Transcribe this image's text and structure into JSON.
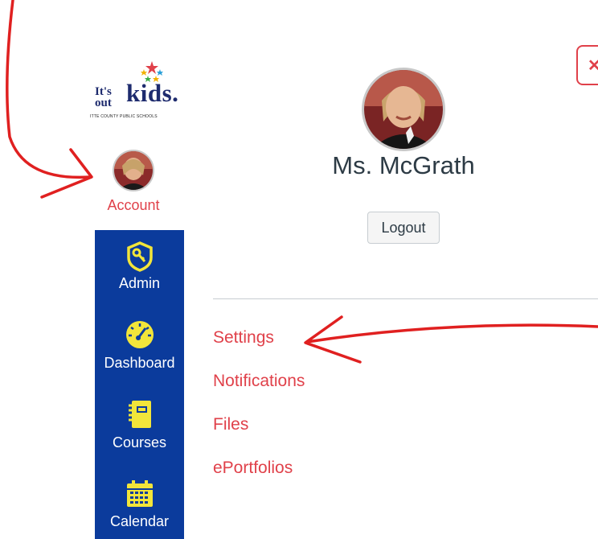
{
  "logo": {
    "tagline_its": "It's",
    "tagline_out": "out",
    "brand": "kids.",
    "subtitle": "ITTE COUNTY PUBLIC SCHOOLS"
  },
  "sidebar": {
    "account_label": "Account",
    "items": [
      {
        "label": "Admin",
        "icon": "shield-key-icon"
      },
      {
        "label": "Dashboard",
        "icon": "dashboard-gauge-icon"
      },
      {
        "label": "Courses",
        "icon": "courses-book-icon"
      },
      {
        "label": "Calendar",
        "icon": "calendar-icon"
      }
    ]
  },
  "profile": {
    "name": "Ms. McGrath",
    "logout_label": "Logout",
    "close_label": "✕",
    "links": [
      "Settings",
      "Notifications",
      "Files",
      "ePortfolios"
    ]
  },
  "colors": {
    "nav_bg": "#0b3b9c",
    "link": "#e0414a",
    "icon_yellow": "#f2e53a",
    "annotation": "#e02020"
  }
}
